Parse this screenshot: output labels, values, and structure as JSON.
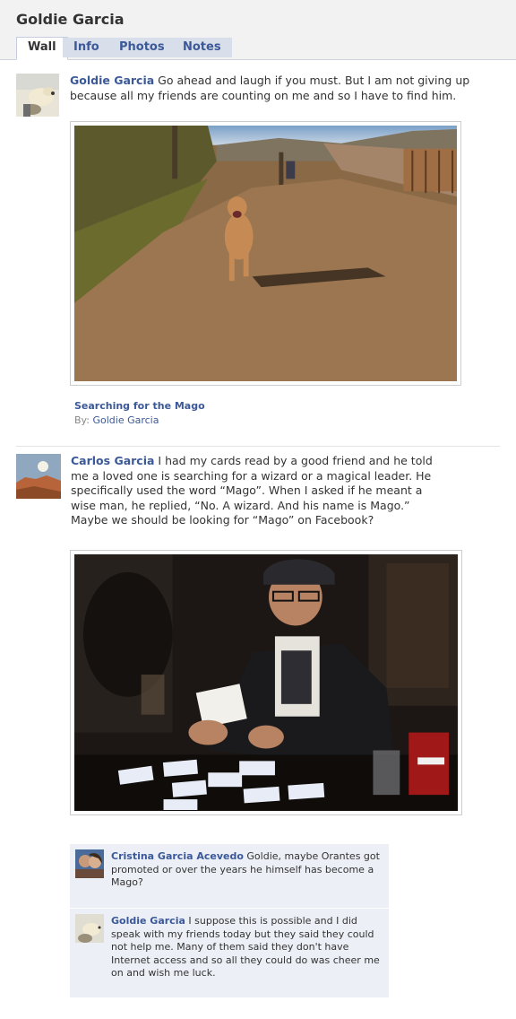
{
  "profile": {
    "name": "Goldie Garcia"
  },
  "tabs": [
    {
      "label": "Wall",
      "active": true
    },
    {
      "label": "Info",
      "active": false
    },
    {
      "label": "Photos",
      "active": false
    },
    {
      "label": "Notes",
      "active": false
    }
  ],
  "posts": [
    {
      "author": "Goldie Garcia",
      "text": "Go ahead and laugh if you must. But I am not giving up because all my friends are counting on me and so I have to find him.",
      "photo": {
        "title": "Searching for the Mago",
        "by_label": "By:",
        "by_name": "Goldie Garcia"
      }
    },
    {
      "author": "Carlos Garcia",
      "text": "I had my cards read by a good friend and he told me a loved one is searching for a wizard or a magical leader. He specifically used the word “Mago”. When I asked if he meant a wise man, he replied, “No. A wizard. And his name is Mago.” Maybe we should be looking for “Mago” on Facebook?",
      "comments": [
        {
          "author": "Cristina Garcia Acevedo",
          "text": "Goldie, maybe Orantes got promoted or over the years he himself has become a Mago?"
        },
        {
          "author": "Goldie Garcia",
          "text": "I suppose this is possible and I did speak with my friends today but they said they could not help me. Many of them said they don't have Internet access and so all they could do was cheer me on and wish me luck."
        }
      ]
    }
  ],
  "colors": {
    "link": "#3b5998",
    "tab_bg": "#d8dfea",
    "comment_bg": "#eceff5"
  }
}
